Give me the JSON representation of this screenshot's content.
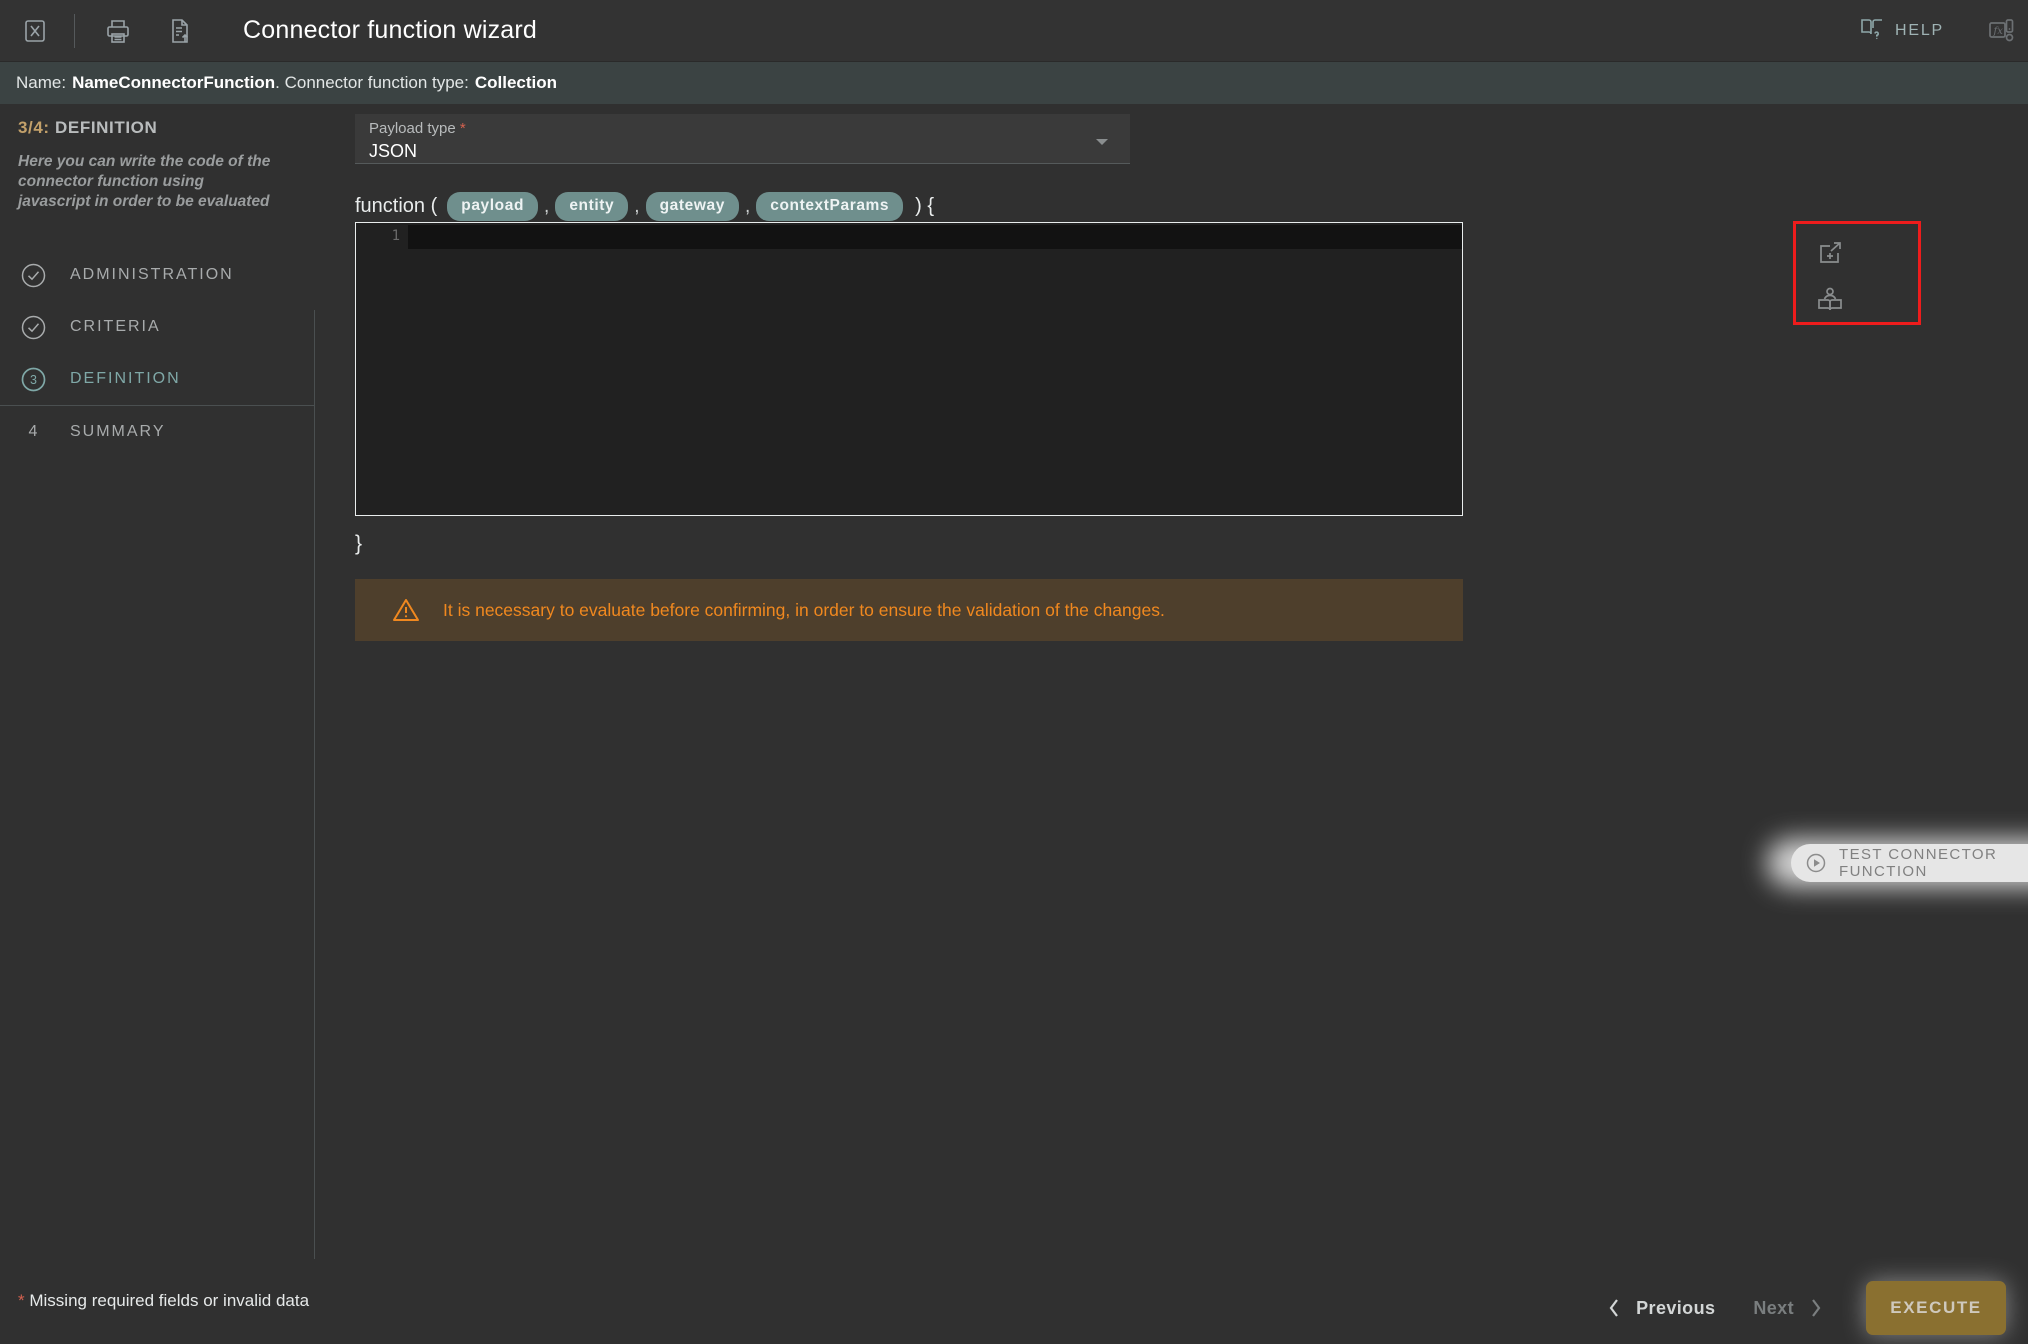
{
  "window": {
    "title": "Connector function wizard",
    "close_icon": "close-box-icon",
    "print_icon": "print-icon",
    "export_icon": "document-export-icon",
    "help_label": "HELP",
    "help_icon": "book-question-icon",
    "fx_icon": "function-fx-icon"
  },
  "subheader": {
    "name_prefix": "Name:",
    "name_value": "NameConnectorFunction",
    "type_prefix": ". Connector function type:",
    "type_value": "Collection"
  },
  "sidebar": {
    "step_fraction": "3/4:",
    "step_name": "DEFINITION",
    "description": "Here you can write the code of the connector function using javascript in order to be evaluated",
    "steps": [
      {
        "label": "ADMINISTRATION",
        "state": "done",
        "marker": "check-circle-icon"
      },
      {
        "label": "CRITERIA",
        "state": "done",
        "marker": "check-circle-icon"
      },
      {
        "label": "DEFINITION",
        "state": "current",
        "marker": "3"
      },
      {
        "label": "SUMMARY",
        "state": "pending",
        "marker": "4"
      }
    ]
  },
  "main": {
    "payload": {
      "label": "Payload type",
      "required_mark": "*",
      "value": "JSON",
      "caret_icon": "chevron-down-icon"
    },
    "signature": {
      "keyword": "function (",
      "params": [
        "payload",
        "entity",
        "gateway",
        "contextParams"
      ],
      "separator": ",",
      "open": ") {",
      "close": "}"
    },
    "editor": {
      "line_number": "1",
      "code": ""
    },
    "side_actions": [
      {
        "icon": "open-in-new-add-icon",
        "name": "add-external-resource"
      },
      {
        "icon": "person-reading-book-icon",
        "name": "open-glossary"
      }
    ],
    "warning": {
      "icon": "warning-triangle-icon",
      "text": "It is necessary to evaluate before confirming, in order to ensure the validation of the changes."
    },
    "test_button": {
      "icon": "play-circle-icon",
      "label": "TEST CONNECTOR FUNCTION"
    }
  },
  "footer": {
    "missing_star": "*",
    "missing_text": "Missing required fields or invalid data",
    "previous_label": "Previous",
    "previous_icon": "chevron-left-icon",
    "next_label": "Next",
    "next_icon": "chevron-right-icon",
    "execute_label": "EXECUTE"
  },
  "colors": {
    "page_bg": "#303030",
    "subheader_bg": "#3b4343",
    "accent_teal": "#7fa8a7",
    "chip_bg": "#6f8f8d",
    "accent_gold": "#c2a06a",
    "warning_orange": "#f0881f",
    "warning_bg": "#4e3f2c",
    "required_red": "#d4614f",
    "highlight_red": "#ee1c1c",
    "execute_bg": "#8a7030",
    "editor_bg": "#212121"
  }
}
